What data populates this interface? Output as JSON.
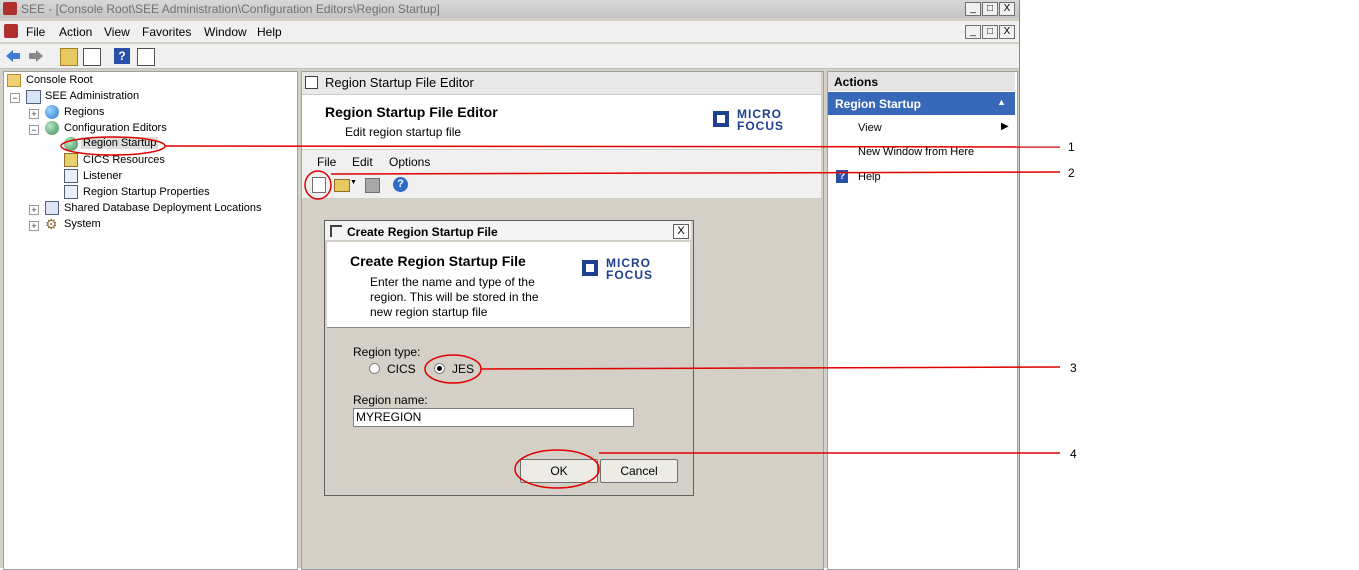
{
  "window": {
    "title": "SEE - [Console Root\\SEE Administration\\Configuration Editors\\Region Startup]",
    "minimize": "_",
    "maximize": "□",
    "close": "X"
  },
  "menubar": [
    "File",
    "Action",
    "View",
    "Favorites",
    "Window",
    "Help"
  ],
  "tree": {
    "root": "Console Root",
    "see_admin": "SEE Administration",
    "regions": "Regions",
    "config_editors": "Configuration Editors",
    "region_startup": "Region Startup",
    "cics_resources": "CICS Resources",
    "listener": "Listener",
    "region_startup_properties": "Region Startup Properties",
    "shared_db": "Shared Database Deployment Locations",
    "system": "System"
  },
  "center": {
    "header": "Region Startup File Editor",
    "title": "Region Startup File Editor",
    "subtitle": "Edit region startup file",
    "menu": [
      "File",
      "Edit",
      "Options"
    ]
  },
  "logo": {
    "line1": "MICRO",
    "line2": "FOCUS"
  },
  "dialog": {
    "title": "Create Region Startup File",
    "heading": "Create Region Startup File",
    "desc1": "Enter the name and type of the",
    "desc2": "region. This will be stored in the",
    "desc3": "new region startup file",
    "region_type_label": "Region type:",
    "option_cics": "CICS",
    "option_jes": "JES",
    "selected": "JES",
    "region_name_label": "Region name:",
    "region_name_value": "MYREGION",
    "ok": "OK",
    "cancel": "Cancel",
    "close": "X"
  },
  "actions": {
    "header": "Actions",
    "section": "Region Startup",
    "items": [
      "View",
      "New Window from Here",
      "Help"
    ]
  },
  "annotations": [
    "1",
    "2",
    "3",
    "4"
  ],
  "colors": {
    "annotation": "#e00000",
    "selection": "#3868b8",
    "brand": "#1f3f8f"
  }
}
